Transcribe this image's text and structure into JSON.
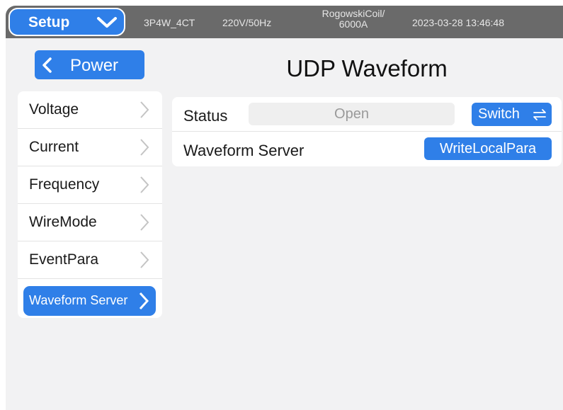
{
  "header": {
    "setup_label": "Setup",
    "wire_mode": "3P4W_4CT",
    "voltage_freq": "220V/50Hz",
    "sensor_line1": "RogowskiCoil/",
    "sensor_line2": "6000A",
    "datetime": "2023-03-28 13:46:48"
  },
  "nav": {
    "back_label": "Power"
  },
  "page": {
    "title": "UDP Waveform"
  },
  "sidebar": {
    "items": [
      {
        "label": "Voltage"
      },
      {
        "label": "Current"
      },
      {
        "label": "Frequency"
      },
      {
        "label": "WireMode"
      },
      {
        "label": "EventPara"
      },
      {
        "label": "Waveform Server"
      }
    ]
  },
  "main": {
    "status_label": "Status",
    "status_value": "Open",
    "switch_label": "Switch",
    "server_label": "Waveform Server",
    "write_label": "WriteLocalPara"
  },
  "colors": {
    "accent": "#2f7fe8",
    "topbar": "#6a6a6a",
    "background": "#f2f2f3"
  }
}
